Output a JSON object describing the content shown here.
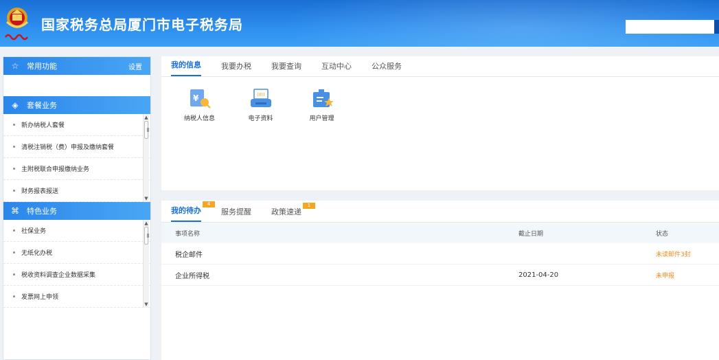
{
  "header": {
    "title": "国家税务总局厦门市电子税务局",
    "search_placeholder": ""
  },
  "sidebar": {
    "favorites": {
      "title": "常用功能",
      "settings_label": "设置"
    },
    "package": {
      "title": "套餐业务",
      "items": [
        "新办纳税人套餐",
        "清税注销税（费）申报及缴纳套餐",
        "主附税联合申报缴纳业务",
        "财务报表报送"
      ]
    },
    "special": {
      "title": "特色业务",
      "items": [
        "社保业务",
        "无纸化办税",
        "税收资料调查企业数据采集",
        "发票网上申领"
      ]
    }
  },
  "info_panel": {
    "tabs": [
      "我的信息",
      "我要办税",
      "我要查询",
      "互动中心",
      "公众服务"
    ],
    "apps": [
      {
        "label": "纳税人信息",
        "icon": "taxpayer-info-icon"
      },
      {
        "label": "电子资料",
        "icon": "electronic-data-icon"
      },
      {
        "label": "用户管理",
        "icon": "user-management-icon"
      }
    ]
  },
  "todo_panel": {
    "tabs": [
      {
        "label": "我的待办",
        "badge": "4"
      },
      {
        "label": "服务提醒",
        "badge": ""
      },
      {
        "label": "政策速递",
        "badge": "1"
      }
    ],
    "columns": [
      "事项名称",
      "截止日期",
      "状态"
    ],
    "rows": [
      {
        "name": "税企邮件",
        "date": "",
        "status": "未读邮件3封"
      },
      {
        "name": "企业所得税",
        "date": "2021-04-20",
        "status": "未申报"
      }
    ]
  },
  "colors": {
    "brand_blue": "#1a6fd4",
    "status_orange": "#f08a1c",
    "badge_orange": "#f5a623"
  }
}
